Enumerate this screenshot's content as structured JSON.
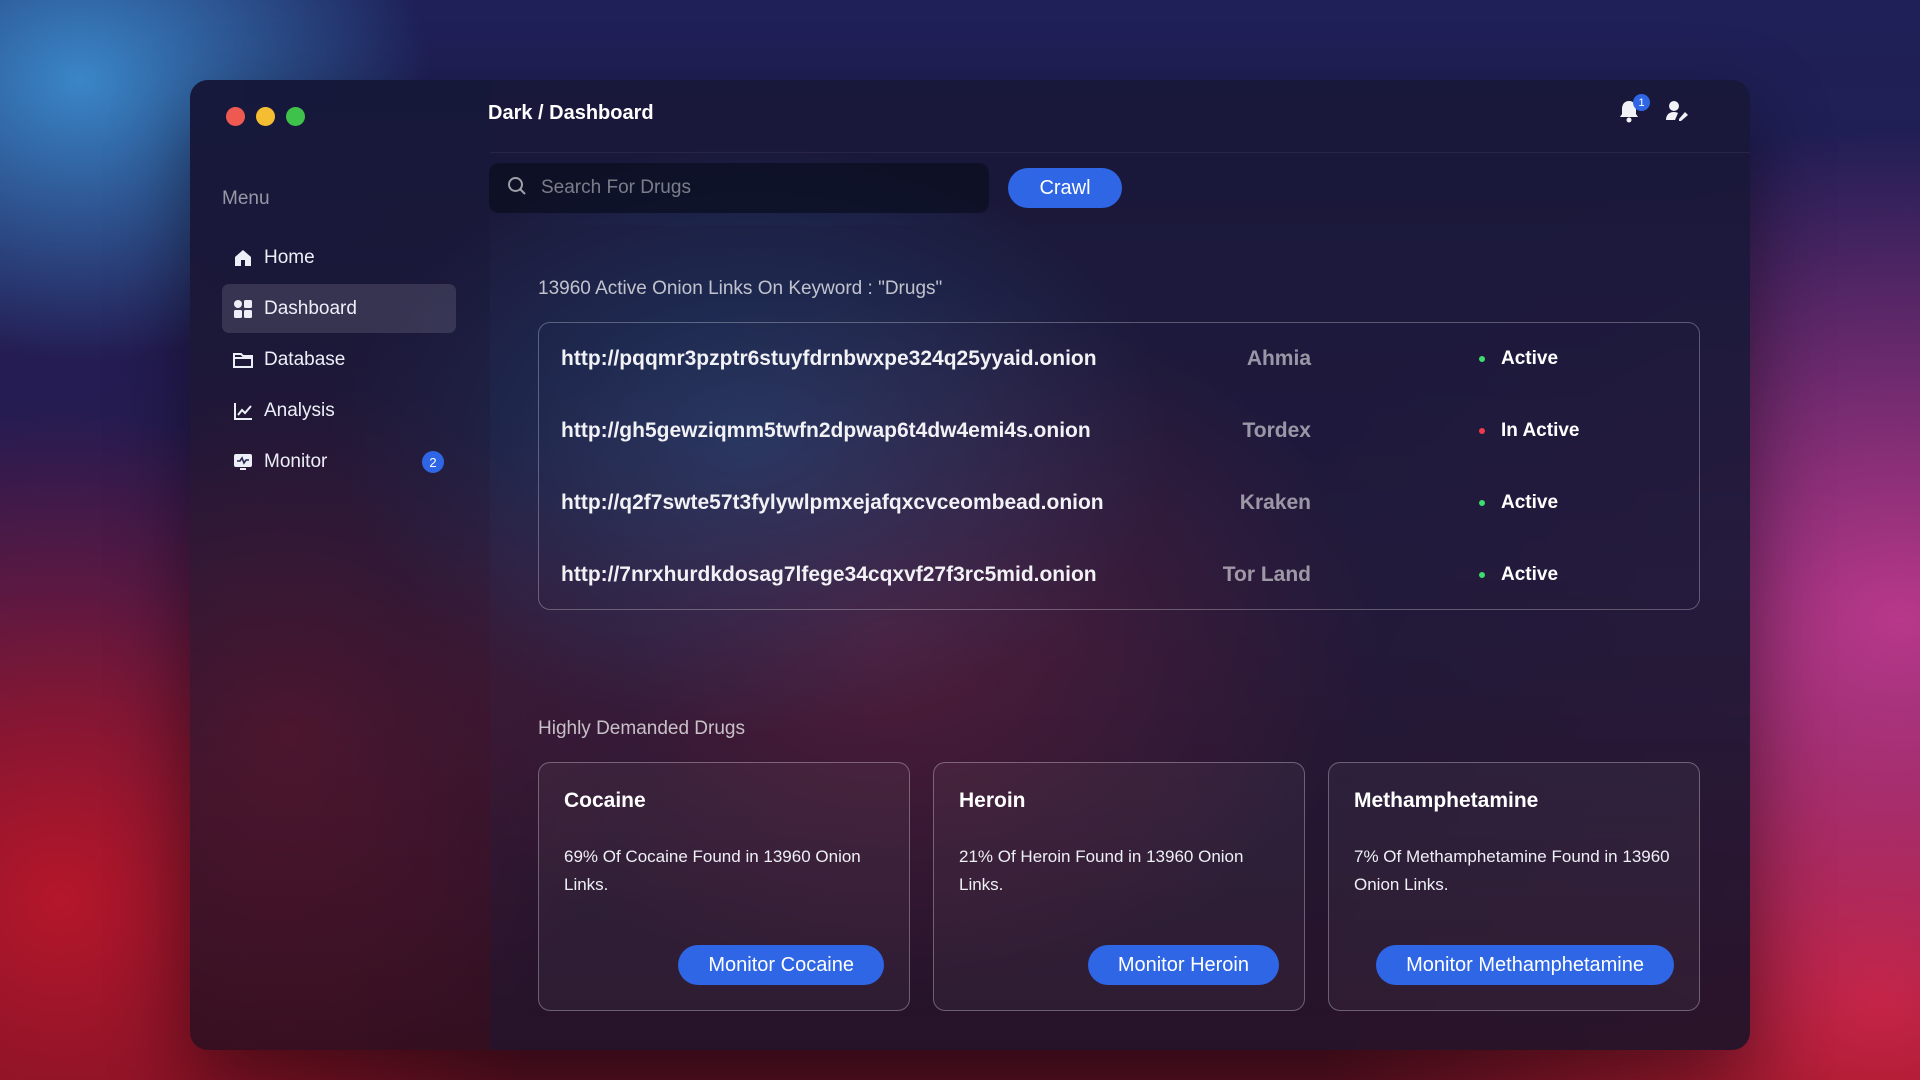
{
  "window": {
    "breadcrumb": "Dark / Dashboard",
    "notification_count": "1"
  },
  "sidebar": {
    "menu_label": "Menu",
    "items": [
      {
        "label": "Home",
        "icon": "home-icon"
      },
      {
        "label": "Dashboard",
        "icon": "dashboard-icon",
        "active": true
      },
      {
        "label": "Database",
        "icon": "folder-icon"
      },
      {
        "label": "Analysis",
        "icon": "chart-icon"
      },
      {
        "label": "Monitor",
        "icon": "monitor-icon",
        "badge": "2"
      }
    ]
  },
  "search": {
    "placeholder": "Search For Drugs",
    "value": "",
    "button_label": "Crawl"
  },
  "results": {
    "title": "13960 Active Onion Links On Keyword : \"Drugs\"",
    "rows": [
      {
        "url": "http://pqqmr3pzptr6stuyfdrnbwxpe324q25yyaid.onion",
        "source": "Ahmia",
        "status": "Active",
        "status_color": "#3ddc6e"
      },
      {
        "url": "http://gh5gewziqmm5twfn2dpwap6t4dw4emi4s.onion",
        "source": "Tordex",
        "status": "In Active",
        "status_color": "#ee3a4a"
      },
      {
        "url": "http://q2f7swte57t3fylywlpmxejafqxcvceombead.onion",
        "source": "Kraken",
        "status": "Active",
        "status_color": "#3ddc6e"
      },
      {
        "url": "http://7nrxhurdkdosag7lfege34cqxvf27f3rc5mid.onion",
        "source": "Tor Land",
        "status": "Active",
        "status_color": "#3ddc6e"
      }
    ]
  },
  "demanded": {
    "title": "Highly Demanded Drugs",
    "cards": [
      {
        "name": "Cocaine",
        "description": "69% Of Cocaine Found in 13960 Onion Links.",
        "button": "Monitor Cocaine"
      },
      {
        "name": "Heroin",
        "description": "21% Of Heroin Found in 13960 Onion Links.",
        "button": "Monitor Heroin"
      },
      {
        "name": "Methamphetamine",
        "description": "7% Of Methamphetamine Found in 13960 Onion Links.",
        "button": "Monitor Methamphetamine"
      }
    ]
  },
  "colors": {
    "accent": "#2f66e6",
    "active": "#3ddc6e",
    "inactive": "#ee3a4a"
  }
}
